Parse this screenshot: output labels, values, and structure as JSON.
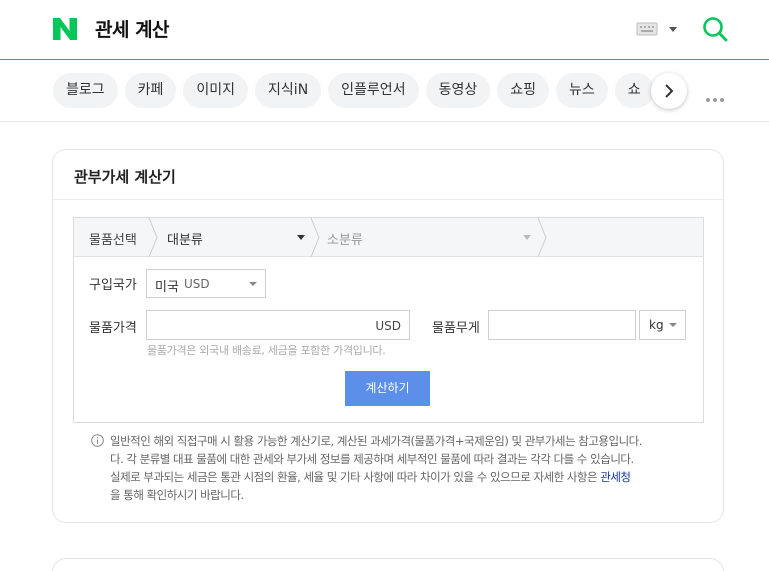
{
  "header": {
    "query": "관세 계산",
    "logo_letter": "N",
    "brand_color": "#03c75a",
    "keyboard_icon": "keyboard-icon",
    "search_icon": "search-icon"
  },
  "tabs": [
    "블로그",
    "카페",
    "이미지",
    "지식iN",
    "인플루언서",
    "동영상",
    "쇼핑",
    "뉴스",
    "쇼"
  ],
  "calculator": {
    "title": "관부가세 계산기",
    "category_label": "물품선택",
    "major_category": "대분류",
    "minor_category": "소분류",
    "country_label": "구입국가",
    "country_value": "미국",
    "country_currency": "USD",
    "price_label": "물품가격",
    "price_value": "",
    "price_unit": "USD",
    "weight_label": "물품무게",
    "weight_value": "",
    "weight_unit": "kg",
    "price_hint": "물품가격은 외국내 배송료, 세금을 포함한 가격입니다.",
    "calc_button": "계산하기",
    "button_color": "#5b8fea"
  },
  "notice": {
    "line1": "일반적인 해외 직접구매 시 활용 가능한 계산기로, 계산된 과세가격(물품가격+국제운임) 및 관부가세는 참고용입니다.",
    "line2": "다. 각 분류별 대표 물품에 대한 관세와 부가세 정보를 제공하며 세부적인 물품에 따라 결과는 각각 다를 수 있습니다.",
    "line3_before": "실제로 부과되는 세금은 통관 시점의 환율, 세율 및 기타 사항에 따라 차이가 있을 수 있으므로 자세한 사항은 ",
    "link": "관세청",
    "line4": "을 통해 확인하시기 바랍니다."
  }
}
